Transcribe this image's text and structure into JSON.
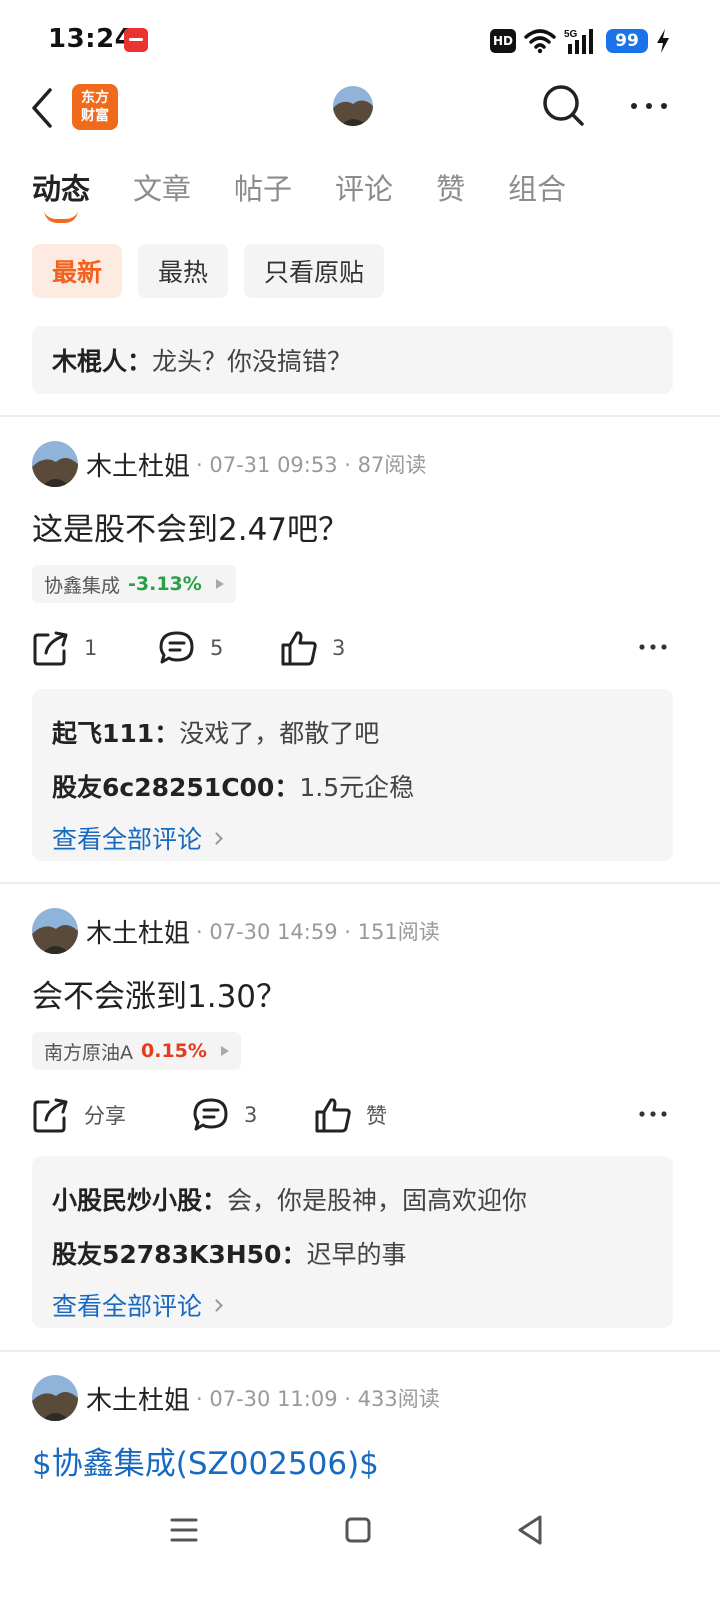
{
  "status_bar": {
    "time": "13:24",
    "hd": "HD",
    "network": "5G",
    "battery": "99"
  },
  "nav": {
    "brand_line1": "东方",
    "brand_line2": "财富"
  },
  "tabs": [
    "动态",
    "文章",
    "帖子",
    "评论",
    "赞",
    "组合"
  ],
  "filters": [
    "最新",
    "最热",
    "只看原贴"
  ],
  "pinned_comment": {
    "author": "木棍人",
    "separator": "：",
    "text": "龙头？你没搞错？"
  },
  "posts": [
    {
      "author": "木土杜姐",
      "meta": "· 07-31 09:53 · 87阅读",
      "title": "这是股不会到2.47吧？",
      "stock": {
        "name": "协鑫集成",
        "change": "-3.13%",
        "direction": "down"
      },
      "actions": {
        "share": "1",
        "comment": "5",
        "like": "3"
      },
      "comments": [
        {
          "author": "起飞111",
          "sep": "：",
          "text": "没戏了，都散了吧"
        },
        {
          "author": "股友6c28251C00",
          "sep": "：",
          "text": "1.5元企稳"
        }
      ],
      "view_all": "查看全部评论"
    },
    {
      "author": "木土杜姐",
      "meta": "· 07-30 14:59 · 151阅读",
      "title": "会不会涨到1.30？",
      "stock": {
        "name": "南方原油A",
        "change": "0.15%",
        "direction": "up"
      },
      "actions": {
        "share": "分享",
        "comment": "3",
        "like": "赞"
      },
      "comments": [
        {
          "author": "小股民炒小股",
          "sep": "：",
          "text": "会，你是股神，固高欢迎你"
        },
        {
          "author": "股友52783K3H50",
          "sep": "：",
          "text": "迟早的事"
        }
      ],
      "view_all": "查看全部评论"
    },
    {
      "author": "木土杜姐",
      "meta": "· 07-30 11:09 · 433阅读",
      "title": "$协鑫集成(SZ002506)$"
    }
  ],
  "colors": {
    "accent": "#f46a1a",
    "link": "#1769c2",
    "down": "#27a046",
    "up": "#e53b1c"
  }
}
